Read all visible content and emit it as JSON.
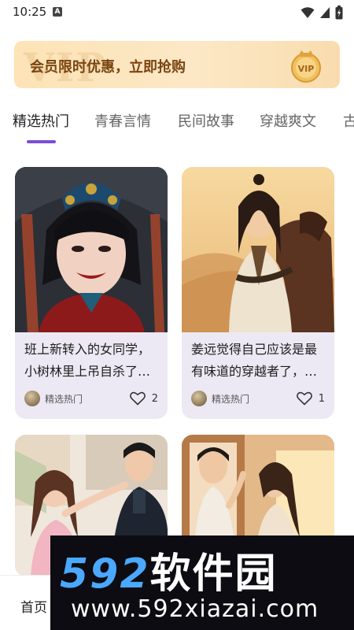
{
  "status_bar": {
    "time": "10:25",
    "notification_glyph": "A",
    "icons": [
      "wifi-icon",
      "signal-icon",
      "battery-icon"
    ]
  },
  "vip_banner": {
    "watermark": "VIP",
    "text": "会员限时优惠，立即抢购",
    "badge_label": "VIP"
  },
  "tabs": [
    {
      "label": "精选热门",
      "active": true
    },
    {
      "label": "青春言情",
      "active": false
    },
    {
      "label": "民间故事",
      "active": false
    },
    {
      "label": "穿越爽文",
      "active": false
    },
    {
      "label": "古",
      "active": false
    }
  ],
  "cards": [
    {
      "title": "班上新转入的女同学，小树林里上吊自杀了…",
      "category": "精选热门",
      "likes": "2"
    },
    {
      "title": "姜远觉得自己应该是最有味道的穿越者了，…",
      "category": "精选热门",
      "likes": "1"
    },
    {
      "title": "",
      "category": "",
      "likes": ""
    },
    {
      "title": "",
      "category": "",
      "likes": ""
    }
  ],
  "bottom_nav": {
    "home": "首页"
  },
  "overlay": {
    "name_digits": "592",
    "name_cn": "软件园",
    "url": "www.592xiazai.com"
  },
  "colors": {
    "accent": "#7b4fd6",
    "vip_text": "#7a4512",
    "card_bg": "#ece9f4"
  }
}
